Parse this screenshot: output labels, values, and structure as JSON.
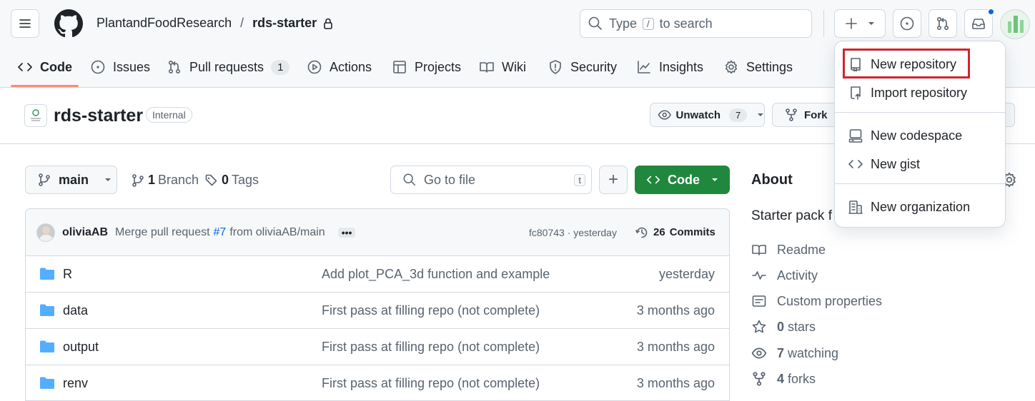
{
  "header": {
    "owner": "PlantandFoodResearch",
    "separator": "/",
    "repo": "rds-starter",
    "search_prefix": "Type",
    "search_key": "/",
    "search_suffix": "to search"
  },
  "nav_tabs": [
    {
      "label": "Code"
    },
    {
      "label": "Issues"
    },
    {
      "label": "Pull requests",
      "count": "1"
    },
    {
      "label": "Actions"
    },
    {
      "label": "Projects"
    },
    {
      "label": "Wiki"
    },
    {
      "label": "Security"
    },
    {
      "label": "Insights"
    },
    {
      "label": "Settings"
    }
  ],
  "repo": {
    "name": "rds-starter",
    "visibility": "Internal",
    "watch_label": "Unwatch",
    "watch_count": "7",
    "fork_label": "Fork"
  },
  "toolbar": {
    "branch": "main",
    "branch_count": "1",
    "branch_label": "Branch",
    "tag_count": "0",
    "tag_label": "Tags",
    "goto_placeholder": "Go to file",
    "goto_key": "t",
    "add_label": "+",
    "code_label": "Code"
  },
  "commit": {
    "author": "oliviaAB",
    "message_pre": "Merge pull request",
    "pr": "#7",
    "message_post": "from oliviaAB/main",
    "hash_time": "fc80743 · yesterday",
    "commits_count": "26",
    "commits_label": "Commits"
  },
  "files": [
    {
      "name": "R",
      "message": "Add plot_PCA_3d function and example",
      "time": "yesterday"
    },
    {
      "name": "data",
      "message": "First pass at filling repo (not complete)",
      "time": "3 months ago"
    },
    {
      "name": "output",
      "message": "First pass at filling repo (not complete)",
      "time": "3 months ago"
    },
    {
      "name": "renv",
      "message": "First pass at filling repo (not complete)",
      "time": "3 months ago"
    }
  ],
  "about": {
    "title": "About",
    "description": "Starter pack f",
    "readme": "Readme",
    "activity": "Activity",
    "custom_properties": "Custom properties",
    "stars_count": "0",
    "stars_label": "stars",
    "watching_count": "7",
    "watching_label": "watching",
    "forks_count": "4",
    "forks_label": "forks"
  },
  "create_menu": {
    "items": [
      {
        "label": "New repository",
        "icon": "repo-icon"
      },
      {
        "label": "Import repository",
        "icon": "repo-push-icon"
      },
      {
        "label": "New codespace",
        "icon": "codespaces-icon"
      },
      {
        "label": "New gist",
        "icon": "code-icon"
      },
      {
        "label": "New organization",
        "icon": "organization-icon"
      }
    ],
    "highlight_color": "#d1242f"
  },
  "colors": {
    "primary_green": "#1f883d",
    "folder_blue": "#54aeff",
    "accent_blue": "#0969da",
    "notification_dot": "#0969da"
  }
}
